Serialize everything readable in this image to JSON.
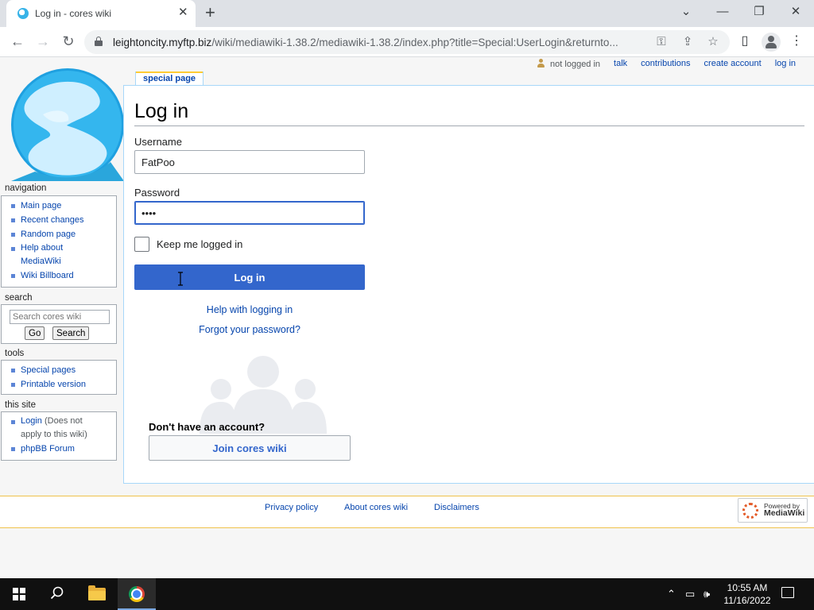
{
  "browser": {
    "tab_title": "Log in - cores wiki",
    "tab_close": "✕",
    "new_tab": "+",
    "url_host": "leightoncity.myftp.biz",
    "url_path": "/wiki/mediawiki-1.38.2/mediawiki-1.38.2/index.php?title=Special:UserLogin&returnto...",
    "window_minimize": "—",
    "window_maximize": "❐",
    "window_close": "✕",
    "chevron": "⌄"
  },
  "personal_tools": {
    "not_logged_in": "not logged in",
    "talk": "talk",
    "contributions": "contributions",
    "create_account": "create account",
    "log_in": "log in"
  },
  "page": {
    "tab_label": "special page",
    "heading": "Log in"
  },
  "login_form": {
    "username_label": "Username",
    "username_value": "FatPoo",
    "password_label": "Password",
    "password_value": "••••",
    "keep_logged_in_label": "Keep me logged in",
    "keep_logged_in_checked": false,
    "submit_label": "Log in",
    "help_link": "Help with logging in",
    "forgot_link": "Forgot your password?",
    "signup_heading": "Don't have an account?",
    "join_label": "Join cores wiki"
  },
  "sidebar": {
    "navigation_title": "navigation",
    "navigation_items": [
      "Main page",
      "Recent changes",
      "Random page",
      "Help about MediaWiki",
      "Wiki Billboard"
    ],
    "search_title": "search",
    "search_placeholder": "Search cores wiki",
    "go_label": "Go",
    "search_label": "Search",
    "tools_title": "tools",
    "tools_items": [
      "Special pages",
      "Printable version"
    ],
    "this_site_title": "this site",
    "login_item": "Login",
    "login_item_note": "(Does not apply to this wiki)",
    "forum_item": "phpBB Forum"
  },
  "footer": {
    "privacy": "Privacy policy",
    "about": "About cores wiki",
    "disclaimers": "Disclaimers",
    "powered_line1": "Powered by",
    "powered_line2": "MediaWiki"
  },
  "taskbar": {
    "time": "10:55 AM",
    "date": "11/16/2022"
  },
  "colors": {
    "link": "#0645ad",
    "primary_button": "#3366cc",
    "tab_bar": "#dee1e6",
    "taskbar": "#101010"
  }
}
